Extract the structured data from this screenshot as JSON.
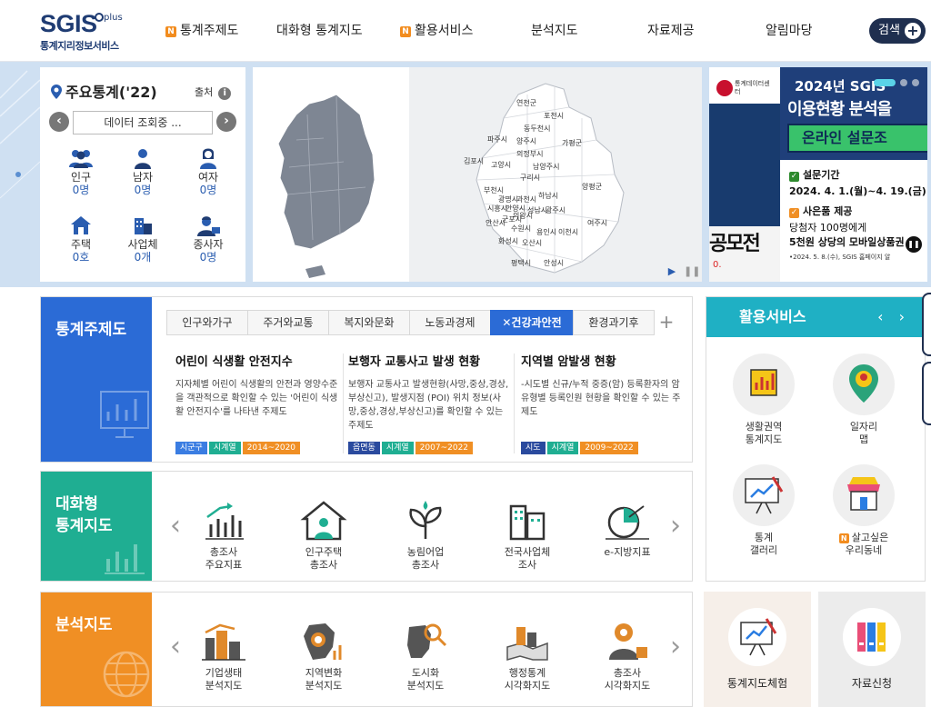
{
  "header": {
    "logo_brand": "SGIS",
    "logo_plus": "plus",
    "logo_subtitle": "통계지리정보서비스",
    "nav": [
      {
        "label": "통계주제도",
        "new": true
      },
      {
        "label": "대화형 통계지도",
        "new": false
      },
      {
        "label": "활용서비스",
        "new": true
      },
      {
        "label": "분석지도",
        "new": false
      },
      {
        "label": "자료제공",
        "new": false
      },
      {
        "label": "알림마당",
        "new": false
      }
    ],
    "new_badge": "N",
    "search_label": "검색",
    "search_plus": "+"
  },
  "stats": {
    "title": "주요통계('22)",
    "source_label": "출처",
    "info_glyph": "i",
    "loading_text": "데이터 조회중 ...",
    "prev": "‹",
    "next": "›",
    "items": [
      {
        "label": "인구",
        "value": "0명",
        "icon": "population-icon"
      },
      {
        "label": "남자",
        "value": "0명",
        "icon": "male-icon"
      },
      {
        "label": "여자",
        "value": "0명",
        "icon": "female-icon"
      },
      {
        "label": "주택",
        "value": "0호",
        "icon": "house-icon"
      },
      {
        "label": "사업체",
        "value": "0개",
        "icon": "business-icon"
      },
      {
        "label": "종사자",
        "value": "0명",
        "icon": "worker-icon"
      }
    ]
  },
  "map": {
    "city_labels": [
      "연천군",
      "포천시",
      "동두천시",
      "파주시",
      "양주시",
      "가평군",
      "의정부시",
      "김포시",
      "고양시",
      "남양주시",
      "구리시",
      "양평군",
      "부천시",
      "광명시",
      "시흥시",
      "안양시",
      "과천시",
      "하남시",
      "광주시",
      "군포시",
      "안산시",
      "의왕시",
      "성남시",
      "수원시",
      "용인시",
      "이천시",
      "여주시",
      "화성시",
      "오산시",
      "평택시",
      "안성시"
    ],
    "play": "▶",
    "pause": "❚❚"
  },
  "banner": {
    "org_name": "통계데이터센터",
    "year_line": "2024년 SGIS",
    "headline": "이용현황 분석을",
    "green_text": "온라인 설문조",
    "period_label": "설문기간",
    "period_value": "2024. 4. 1.(월)~4. 19.(금)",
    "gift_label": "사은품 제공",
    "gift_line1": "당첨자 100명에게",
    "gift_line2": "5천원 상당의 모바일상품권 7",
    "note": "•2024. 5. 8.(수), SGIS 홈페이지 알",
    "left_big": "공모전",
    "left_mini": "0.",
    "check_glyph": "✓",
    "pause_glyph": "❚❚"
  },
  "theme": {
    "label": "통계주제도",
    "tabs": [
      "인구와가구",
      "주거와교통",
      "복지와문화",
      "노동과경제",
      "건강과안전",
      "환경과기후"
    ],
    "active_tab": "건강과안전",
    "tab_plus": "+",
    "topics": [
      {
        "title": "어린이 식생활 안전지수",
        "desc": "지자체별 어린이 식생활의 안전과 영양수준을 객관적으로 확인할 수 있는 '어린이 식생활 안전지수'를 나타낸 주제도",
        "tags": [
          {
            "text": "시군구",
            "color": "blue"
          },
          {
            "text": "시계열",
            "color": "green"
          },
          {
            "text": "2014~2020",
            "color": "orange"
          }
        ]
      },
      {
        "title": "보행자 교통사고 발생 현황",
        "desc": "보행자 교통사고 발생현황(사망,중상,경상,부상신고), 발생지점 (POI) 위치 정보(사망,중상,경상,부상신고)를 확인할 수 있는 주제도",
        "tags": [
          {
            "text": "읍면동",
            "color": "navy"
          },
          {
            "text": "시계열",
            "color": "green"
          },
          {
            "text": "2007~2022",
            "color": "orange"
          }
        ]
      },
      {
        "title": "지역별 암발생 현황",
        "desc": "-시도별 신규/누적 중증(암) 등록환자의 암유형별 등록인원 현황을 확인할 수 있는 주제도",
        "tags": [
          {
            "text": "시도",
            "color": "navy"
          },
          {
            "text": "시계열",
            "color": "green"
          },
          {
            "text": "2009~2022",
            "color": "orange"
          }
        ]
      }
    ]
  },
  "interactive": {
    "label_line1": "대화형",
    "label_line2": "통계지도",
    "prev": "‹",
    "next": "›",
    "items": [
      {
        "line1": "총조사",
        "line2": "주요지표"
      },
      {
        "line1": "인구주택",
        "line2": "총조사"
      },
      {
        "line1": "농림어업",
        "line2": "총조사"
      },
      {
        "line1": "전국사업체",
        "line2": "조사"
      },
      {
        "line1": "e-지방지표",
        "line2": ""
      }
    ]
  },
  "analysis": {
    "label": "분석지도",
    "prev": "‹",
    "next": "›",
    "items": [
      {
        "line1": "기업생태",
        "line2": "분석지도"
      },
      {
        "line1": "지역변화",
        "line2": "분석지도"
      },
      {
        "line1": "도시화",
        "line2": "분석지도"
      },
      {
        "line1": "행정통계",
        "line2": "시각화지도"
      },
      {
        "line1": "총조사",
        "line2": "시각화지도"
      }
    ]
  },
  "services": {
    "title": "활용서비스",
    "arrows": "‹ ›",
    "items": [
      {
        "line1": "생활권역",
        "line2": "통계지도",
        "new": false
      },
      {
        "line1": "일자리",
        "line2": "맵",
        "new": false
      },
      {
        "line1": "통계",
        "line2": "갤러리",
        "new": false
      },
      {
        "line1": "살고싶은",
        "line2": "우리동네",
        "new": true
      }
    ]
  },
  "bottom_buttons": {
    "experience": "통계지도체험",
    "data_request": "자료신청"
  },
  "colors": {
    "navy": "#1f3c73",
    "theme_blue": "#2b6bd6",
    "interactive_green": "#1fae92",
    "analysis_orange": "#f08f24",
    "service_teal": "#1fb0c4",
    "new_orange": "#f28c1e"
  }
}
